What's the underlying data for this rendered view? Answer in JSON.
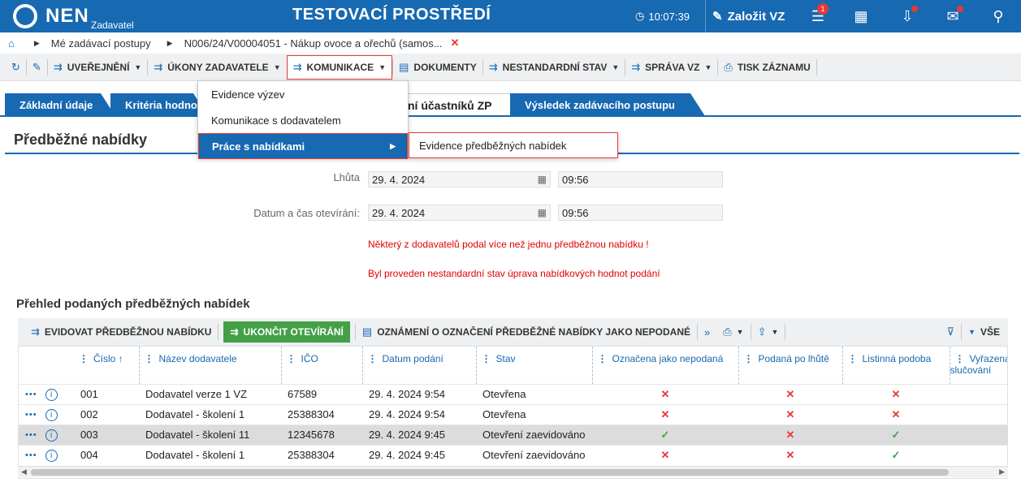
{
  "topbar": {
    "logo_text": "NEN",
    "logo_sub": "Zadavatel",
    "env_title": "TESTOVACÍ PROSTŘEDÍ",
    "clock": "10:07:39",
    "create_label": "Založit VZ",
    "notif_count": "1",
    "icons": [
      "clock-icon",
      "edit-icon",
      "menu-icon",
      "calculator-icon",
      "inbox-icon",
      "mail-icon",
      "user-icon"
    ]
  },
  "breadcrumb": {
    "item1": "Mé zadávací postupy",
    "item2": "N006/24/V00004051 - Nákup ovoce a ořechů (samos..."
  },
  "actionbar": {
    "publish": "UVEŘEJNĚNÍ",
    "acts": "ÚKONY ZADAVATELE",
    "communication": "KOMUNIKACE",
    "documents": "DOKUMENTY",
    "nonstandard": "NESTANDARDNÍ STAV",
    "management": "SPRÁVA VZ",
    "print": "TISK ZÁZNAMU"
  },
  "menu": {
    "items": [
      "Evidence výzev",
      "Komunikace s dodavatelem",
      "Práce s nabídkami"
    ],
    "submenu": "Evidence předběžných nabídek"
  },
  "tabs": [
    "Základní údaje",
    "Kritéria hodno",
    "ní účastníků ZP",
    "Výsledek zadávacího postupu"
  ],
  "page_title": "Předběžné nabídky",
  "form": {
    "deadline_label": "Lhůta",
    "deadline_date": "29. 4. 2024",
    "deadline_time": "09:56",
    "opening_label": "Datum a čas otevírání:",
    "opening_date": "29. 4. 2024",
    "opening_time": "09:56",
    "warning1": "Některý z dodavatelů podal více než jednu předběžnou nabídku !",
    "warning2": "Byl proveden nestandardní stav úprava nabídkových hodnot podání"
  },
  "section_title": "Přehled podaných předběžných nabídek",
  "gridbar": {
    "record": "EVIDOVAT PŘEDBĚŽNOU NABÍDKU",
    "finish": "UKONČIT OTEVÍRÁNÍ",
    "notice": "OZNÁMENÍ O OZNAČENÍ PŘEDBĚŽNÉ NABÍDKY JAKO NEPODANÉ",
    "all": "VŠE"
  },
  "table": {
    "headers": [
      "Číslo",
      "Název dodavatele",
      "IČO",
      "Datum podání",
      "Stav",
      "Označena jako nepodaná",
      "Podaná po lhůtě",
      "Listinná podoba",
      "Vyřazena slučování"
    ],
    "rows": [
      {
        "num": "001",
        "name": "Dodavatel verze 1 VZ",
        "ico": "67589",
        "date": "29. 4. 2024 9:54",
        "state": "Otevřena",
        "nepod": "x",
        "polhute": "x",
        "listinna": "x"
      },
      {
        "num": "002",
        "name": "Dodavatel - školení 1",
        "ico": "25388304",
        "date": "29. 4. 2024 9:54",
        "state": "Otevřena",
        "nepod": "x",
        "polhute": "x",
        "listinna": "x"
      },
      {
        "num": "003",
        "name": "Dodavatel - školení 11",
        "ico": "12345678",
        "date": "29. 4. 2024 9:45",
        "state": "Otevření zaevidováno",
        "nepod": "ok",
        "polhute": "x",
        "listinna": "ok"
      },
      {
        "num": "004",
        "name": "Dodavatel - školení 1",
        "ico": "25388304",
        "date": "29. 4. 2024 9:45",
        "state": "Otevření zaevidováno",
        "nepod": "x",
        "polhute": "x",
        "listinna": "ok"
      }
    ]
  },
  "colors": {
    "primary": "#1769b1",
    "accent_red": "#e53935",
    "green": "#43a047"
  }
}
